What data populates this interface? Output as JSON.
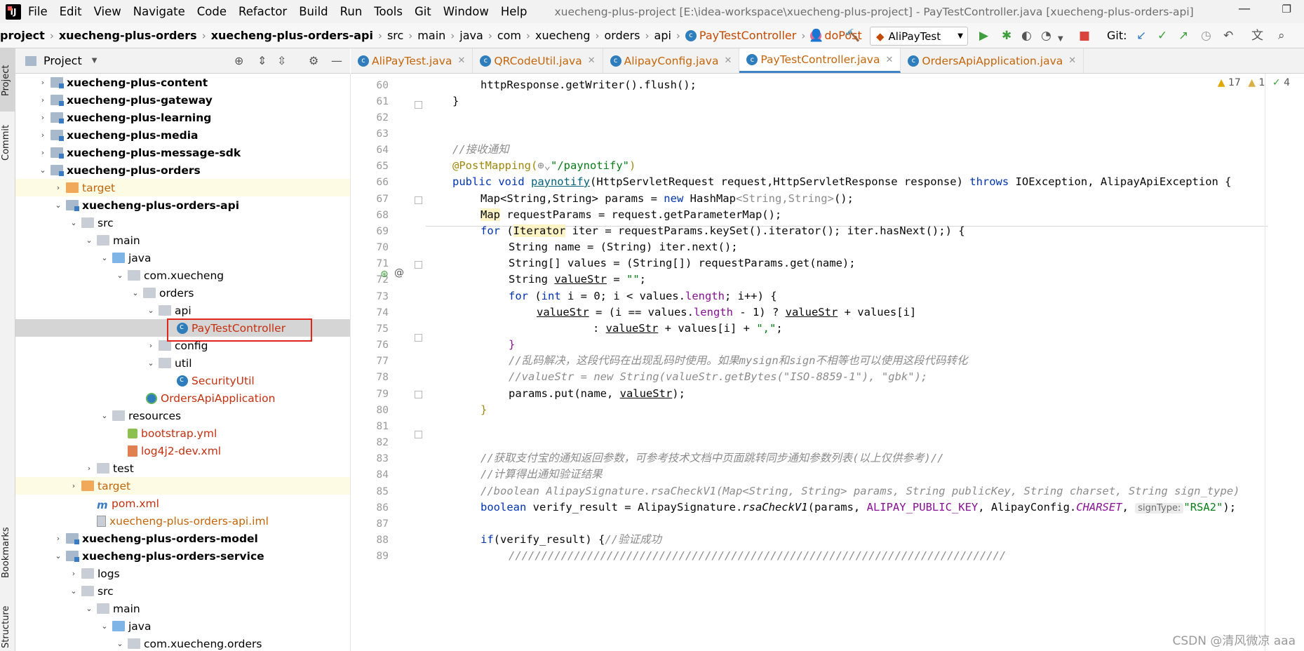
{
  "menubar": {
    "items": [
      "File",
      "Edit",
      "View",
      "Navigate",
      "Code",
      "Refactor",
      "Build",
      "Run",
      "Tools",
      "Git",
      "Window",
      "Help"
    ],
    "window_title": "xuecheng-plus-project [E:\\idea-workspace\\xuecheng-plus-project] - PayTestController.java [xuecheng-plus-orders-api]"
  },
  "breadcrumb": {
    "items": [
      "project",
      "xuecheng-plus-orders",
      "xuecheng-plus-orders-api",
      "src",
      "main",
      "java",
      "com",
      "xuecheng",
      "orders",
      "api",
      "PayTestController",
      "doPost"
    ]
  },
  "toolbar": {
    "run_config": "AliPayTest",
    "git_label": "Git:"
  },
  "left_tool": {
    "project": "Project",
    "commit": "Commit",
    "bookmarks": "Bookmarks",
    "structure": "Structure"
  },
  "project_panel": {
    "title": "Project",
    "tree": [
      {
        "label": "xuecheng-plus-content"
      },
      {
        "label": "xuecheng-plus-gateway"
      },
      {
        "label": "xuecheng-plus-learning"
      },
      {
        "label": "xuecheng-plus-media"
      },
      {
        "label": "xuecheng-plus-message-sdk"
      },
      {
        "label": "xuecheng-plus-orders"
      },
      {
        "label": "target"
      },
      {
        "label": "xuecheng-plus-orders-api"
      },
      {
        "label": "src"
      },
      {
        "label": "main"
      },
      {
        "label": "java"
      },
      {
        "label": "com.xuecheng"
      },
      {
        "label": "orders"
      },
      {
        "label": "api"
      },
      {
        "label": "PayTestController"
      },
      {
        "label": "config"
      },
      {
        "label": "util"
      },
      {
        "label": "SecurityUtil"
      },
      {
        "label": "OrdersApiApplication"
      },
      {
        "label": "resources"
      },
      {
        "label": "bootstrap.yml"
      },
      {
        "label": "log4j2-dev.xml"
      },
      {
        "label": "test"
      },
      {
        "label": "target"
      },
      {
        "label": "pom.xml"
      },
      {
        "label": "xuecheng-plus-orders-api.iml"
      },
      {
        "label": "xuecheng-plus-orders-model"
      },
      {
        "label": "xuecheng-plus-orders-service"
      },
      {
        "label": "logs"
      },
      {
        "label": "src"
      },
      {
        "label": "main"
      },
      {
        "label": "java"
      },
      {
        "label": "com.xuecheng.orders"
      }
    ]
  },
  "editor_tabs": [
    "AliPayTest.java",
    "QRCodeUtil.java",
    "AlipayConfig.java",
    "PayTestController.java",
    "OrdersApiApplication.java"
  ],
  "inspection": {
    "warnings": "17",
    "weak": "1",
    "ok": "4"
  },
  "line_numbers": [
    "60",
    "61",
    "62",
    "63",
    "64",
    "65",
    "66",
    "67",
    "68",
    "69",
    "70",
    "71",
    "72",
    "73",
    "74",
    "75",
    "76",
    "77",
    "78",
    "79",
    "80",
    "81",
    "82",
    "83",
    "84",
    "85",
    "86",
    "87",
    "88",
    "89"
  ],
  "code": {
    "l60": "httpResponse.getWriter().flush();",
    "l61": "}",
    "l64": "//接收通知",
    "l65a": "@PostMapping(",
    "l65b": "\"/paynotify\"",
    "l65c": ")",
    "l66a": "public void ",
    "l66b": "paynotify",
    "l66c": "(HttpServletRequest request,HttpServletResponse response) ",
    "l66d": "throws",
    "l66e": " IOException, AlipayApiException {",
    "l67a": "Map<String,String> params = ",
    "l67b": "new",
    "l67c": " HashMap",
    "l67d": "<String,String>",
    "l67e": "();",
    "l68a": "Map",
    "l68b": " requestParams = request.getParameterMap();",
    "l69a": "for",
    "l69b": " (",
    "l69c": "Iterator",
    "l69d": " iter = requestParams.keySet().iterator(); iter.hasNext();) {",
    "l70": "String name = (String) iter.next();",
    "l71": "String[] values = (String[]) requestParams.get(name);",
    "l72a": "String ",
    "l72b": "valueStr",
    "l72c": " = ",
    "l72d": "\"\"",
    "l72e": ";",
    "l73a": "for",
    "l73b": " (",
    "l73c": "int",
    "l73d": " i = 0; i < values.",
    "l73e": "length",
    "l73f": "; i++) {",
    "l74a": "valueStr",
    "l74b": " = (i == values.",
    "l74c": "length",
    "l74d": " - 1) ? ",
    "l74e": "valueStr",
    "l74f": " + values[i]",
    "l75a": ": ",
    "l75b": "valueStr",
    "l75c": " + values[i] + ",
    "l75d": "\",\"",
    "l75e": ";",
    "l76": "}",
    "l77": "//乱码解决，这段代码在出现乱码时使用。如果mysign和sign不相等也可以使用这段代码转化",
    "l78": "//valueStr = new String(valueStr.getBytes(\"ISO-8859-1\"), \"gbk\");",
    "l79a": "params.put(name, ",
    "l79b": "valueStr",
    "l79c": ");",
    "l80": "}",
    "l83": "//获取支付宝的通知返回参数，可参考技术文档中页面跳转同步通知参数列表(以上仅供参考)//",
    "l84": "//计算得出通知验证结果",
    "l85": "//boolean AlipaySignature.rsaCheckV1(Map<String, String> params, String publicKey, String charset, String sign_type)",
    "l86a": "boolean",
    "l86b": " verify_result = AlipaySignature.",
    "l86c": "rsaCheckV1",
    "l86d": "(params, ",
    "l86e": "ALIPAY_PUBLIC_KEY",
    "l86f": ", AlipayConfig.",
    "l86g": "CHARSET",
    "l86h": ", ",
    "l86i": "signType:",
    "l86j": "\"RSA2\"",
    "l86k": ");",
    "l88a": "if",
    "l88b": "(verify_result) {",
    "l88c": "//验证成功",
    "l89": "////////////////////////////////////////////////////////////////////////////"
  },
  "watermark": "CSDN @清风微凉 aaa"
}
